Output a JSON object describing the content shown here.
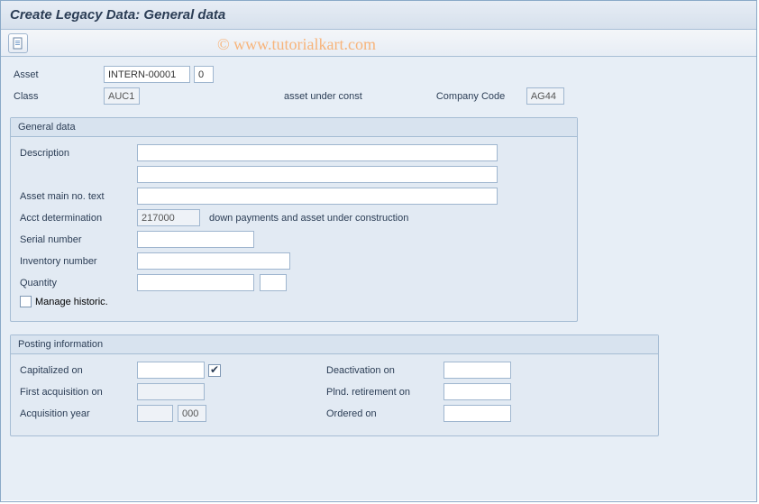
{
  "title": "Create Legacy Data: General data",
  "watermark": "© www.tutorialkart.com",
  "header": {
    "labels": {
      "asset": "Asset",
      "class": "Class",
      "class_desc": "asset under const",
      "company_code": "Company Code"
    },
    "values": {
      "asset": "INTERN-00001",
      "subnumber": "0",
      "class": "AUC1",
      "company_code": "AG44"
    }
  },
  "general": {
    "title": "General data",
    "labels": {
      "description": "Description",
      "asset_main_text": "Asset main no. text",
      "acct_determination": "Acct determination",
      "acct_determ_desc": "down payments and asset under construction",
      "serial_number": "Serial number",
      "inventory_number": "Inventory number",
      "quantity": "Quantity",
      "manage_historic": "Manage historic."
    },
    "values": {
      "description": "",
      "description2": "",
      "asset_main_text": "",
      "acct_determination": "217000",
      "serial_number": "",
      "inventory_number": "",
      "quantity": "",
      "unit": "",
      "manage_historic": false
    }
  },
  "posting": {
    "title": "Posting information",
    "labels": {
      "capitalized_on": "Capitalized on",
      "first_acquisition_on": "First acquisition on",
      "acquisition_year": "Acquisition year",
      "deactivation_on": "Deactivation on",
      "plnd_retirement_on": "Plnd. retirement on",
      "ordered_on": "Ordered on"
    },
    "values": {
      "capitalized_on": "",
      "first_acquisition_on": "",
      "acquisition_year": "",
      "acquisition_period": "000",
      "deactivation_on": "",
      "plnd_retirement_on": "",
      "ordered_on": ""
    }
  }
}
